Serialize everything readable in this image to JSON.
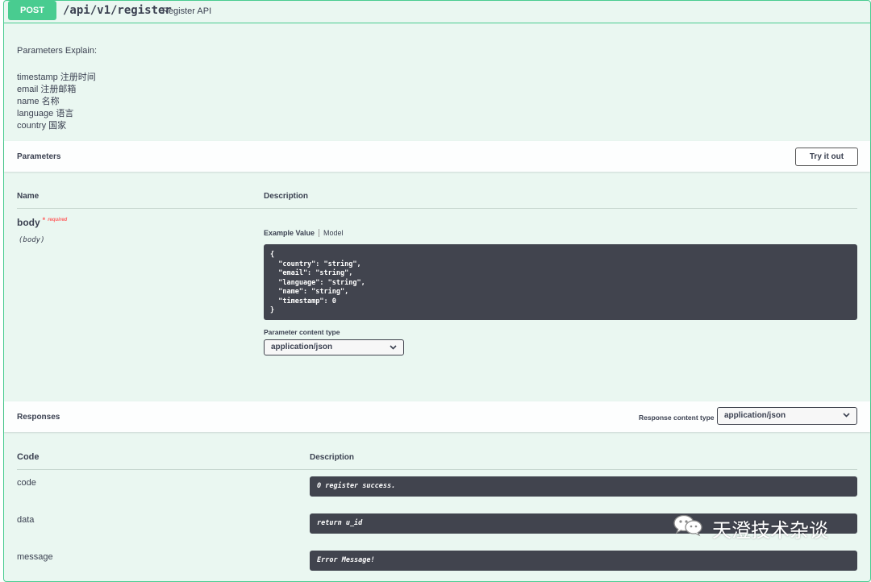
{
  "operation": {
    "method": "POST",
    "path": "/api/v1/register",
    "summary": "Register API"
  },
  "explain": {
    "title": "Parameters Explain:",
    "lines": [
      "timestamp 注册时间",
      "email 注册邮箱",
      "name 名称",
      "language 语言",
      "country 国家"
    ]
  },
  "parameters": {
    "title": "Parameters",
    "try_button": "Try it out",
    "col_name": "Name",
    "col_description": "Description",
    "param": {
      "name": "body",
      "required_marker": "*",
      "required_text": "required",
      "in": "(body)"
    },
    "tab_example": "Example Value",
    "tab_model": "Model",
    "example_lines": [
      "{",
      "  \"country\": \"string\",",
      "  \"email\": \"string\",",
      "  \"language\": \"string\",",
      "  \"name\": \"string\",",
      "  \"timestamp\": 0",
      "}"
    ],
    "content_type_label": "Parameter content type",
    "content_type_value": "application/json"
  },
  "responses": {
    "title": "Responses",
    "content_type_label": "Response content type",
    "content_type_value": "application/json",
    "col_code": "Code",
    "col_description": "Description",
    "rows": [
      {
        "code": "code",
        "description": "0 register success."
      },
      {
        "code": "data",
        "description": "return u_id"
      },
      {
        "code": "message",
        "description": "Error Message!"
      }
    ]
  },
  "watermark": {
    "icon": "wechat-icon",
    "text": "天澄技术杂谈"
  },
  "colors": {
    "post_accent": "#49cc90",
    "block_bg": "#eaf7f1",
    "code_bg": "#41444e",
    "required": "#ff6060"
  }
}
